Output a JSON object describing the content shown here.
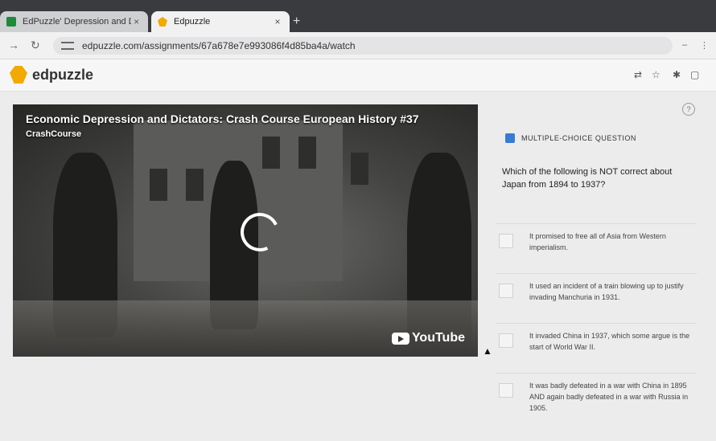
{
  "browser": {
    "tabs": [
      {
        "title": "EdPuzzle' Depression and Dic",
        "icon": "google-classroom-icon",
        "active": false
      },
      {
        "title": "Edpuzzle",
        "icon": "edpuzzle-icon",
        "active": true
      }
    ],
    "new_tab": "+",
    "close_glyph": "×",
    "url": "edpuzzle.com/assignments/67a678e7e993086f4d85ba4a/watch"
  },
  "app": {
    "logo_text": "edpuzzle"
  },
  "video": {
    "title": "Economic Depression and Dictators: Crash Course European History #37",
    "channel": "CrashCourse",
    "brand": "YouTube"
  },
  "question": {
    "type_label": "MULTIPLE-CHOICE QUESTION",
    "text": "Which of the following is NOT correct about Japan from 1894 to 1937?",
    "options": [
      "It promised to free all of Asia from Western imperialism.",
      "It used an incident of a train blowing up to justify invading Manchuria in 1931.",
      "It invaded China in 1937, which some argue is the start of World War II.",
      "It was badly defeated in a war with China in 1895 AND again badly defeated in a war with Russia in 1905."
    ]
  },
  "colors": {
    "accent": "#f2a900",
    "question_icon": "#3a7bd5"
  }
}
